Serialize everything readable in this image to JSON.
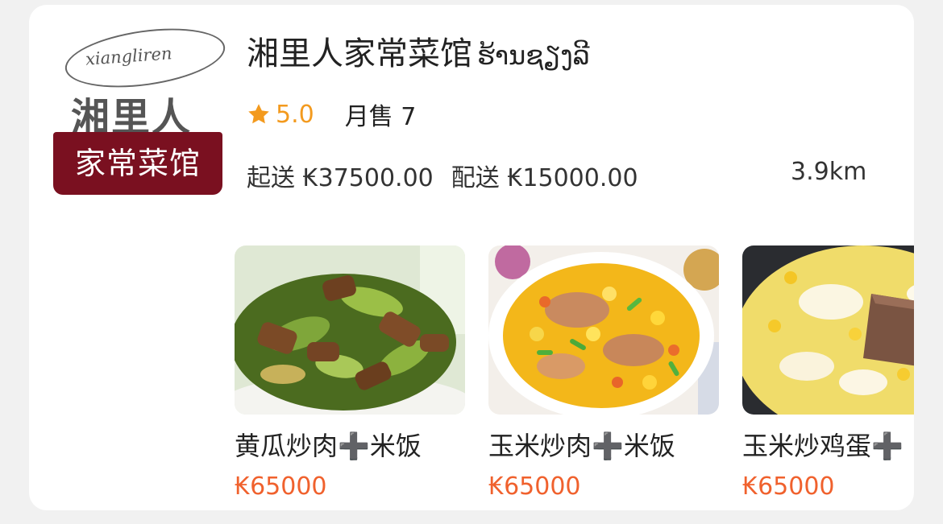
{
  "store": {
    "name": "湘里人家常菜馆",
    "name_lao": "ຮ້ານຊຽງລີ",
    "rating": "5.0",
    "monthly_sales": "月售 7",
    "min_order": "起送 ₭37500.00",
    "delivery_fee": "配送 ₭15000.00",
    "distance": "3.9km",
    "logo": {
      "script_text": "xiangliren",
      "chars": "湘里人",
      "banner_text": "家常菜馆"
    }
  },
  "dishes": [
    {
      "name": "黄瓜炒肉➕米饭",
      "price": "₭65000",
      "image": "cucumber-pork-photo"
    },
    {
      "name": "玉米炒肉➕米饭",
      "price": "₭65000",
      "image": "corn-pork-photo"
    },
    {
      "name": "玉米炒鸡蛋➕",
      "price": "₭65000",
      "image": "corn-egg-photo"
    }
  ],
  "colors": {
    "accent": "#f39a1e",
    "price": "#f0612d",
    "logo_banner": "#7a1020"
  }
}
